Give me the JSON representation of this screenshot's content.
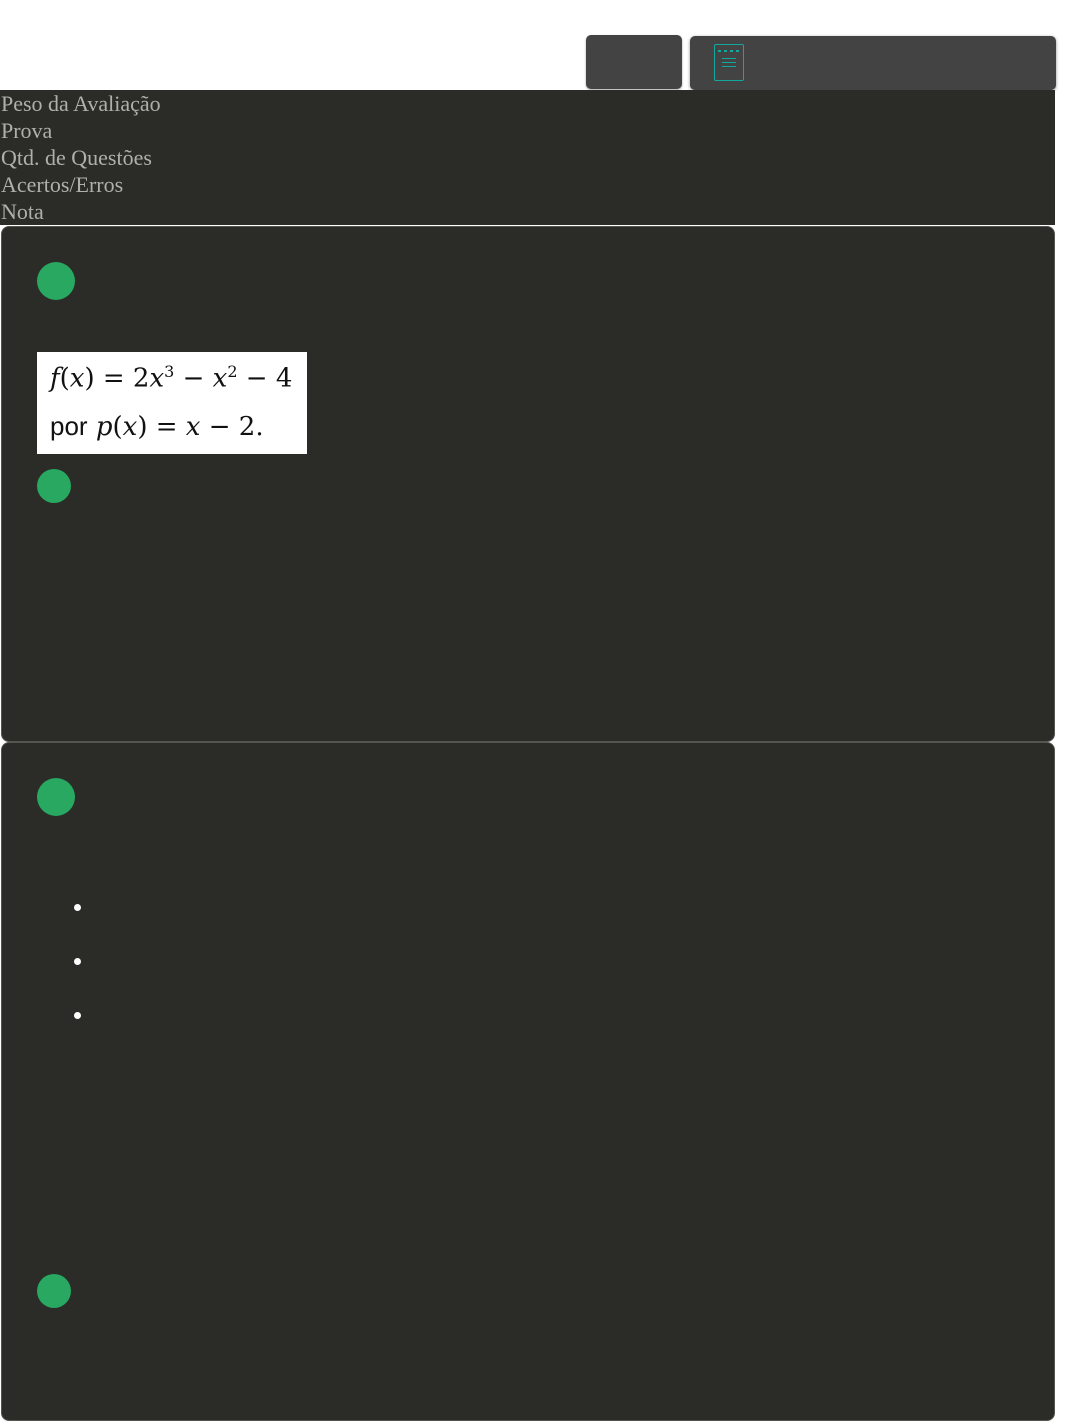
{
  "toolbar": {
    "small_button_icon": "none",
    "wide_button_icon": "document-icon"
  },
  "info_header": {
    "rows": [
      "Peso da Avaliação",
      "Prova",
      "Qtd. de Questões",
      "Acertos/Erros",
      "Nota"
    ]
  },
  "question_1": {
    "formula": {
      "line1": "f(x) = 2x³ − x² − 4",
      "line2_prefix": "por",
      "line2_expr": "p(x) = x − 2."
    }
  },
  "colors": {
    "status_dot": "#28a860",
    "card_background": "#2b2b27",
    "accent": "#12a89d"
  }
}
